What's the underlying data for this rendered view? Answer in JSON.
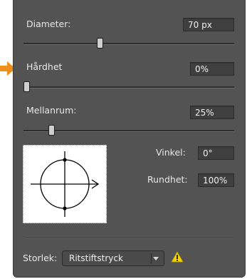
{
  "brush": {
    "diameter": {
      "label": "Diameter:",
      "value": "70 px",
      "slider_level": 0.42
    },
    "hardness": {
      "label": "Hårdhet",
      "value": "0%",
      "slider_level": 0.0
    },
    "spacing": {
      "label": "Mellanrum:",
      "value": "25%",
      "slider_level": 0.12
    },
    "angle": {
      "label": "Vinkel:",
      "value": "0°"
    },
    "roundness": {
      "label": "Rundhet:",
      "value": "100%"
    }
  },
  "footer": {
    "size_label": "Storlek:",
    "size_value": "Ritstiftstryck"
  },
  "icons": {
    "pointer": "arrow-pointer-icon",
    "dropdown": "chevron-down-icon",
    "warning": "warning-icon"
  },
  "colors": {
    "panel": "#535353",
    "field": "#3f3f3f",
    "pointer": "#f0901c",
    "warning": "#f5d300"
  }
}
